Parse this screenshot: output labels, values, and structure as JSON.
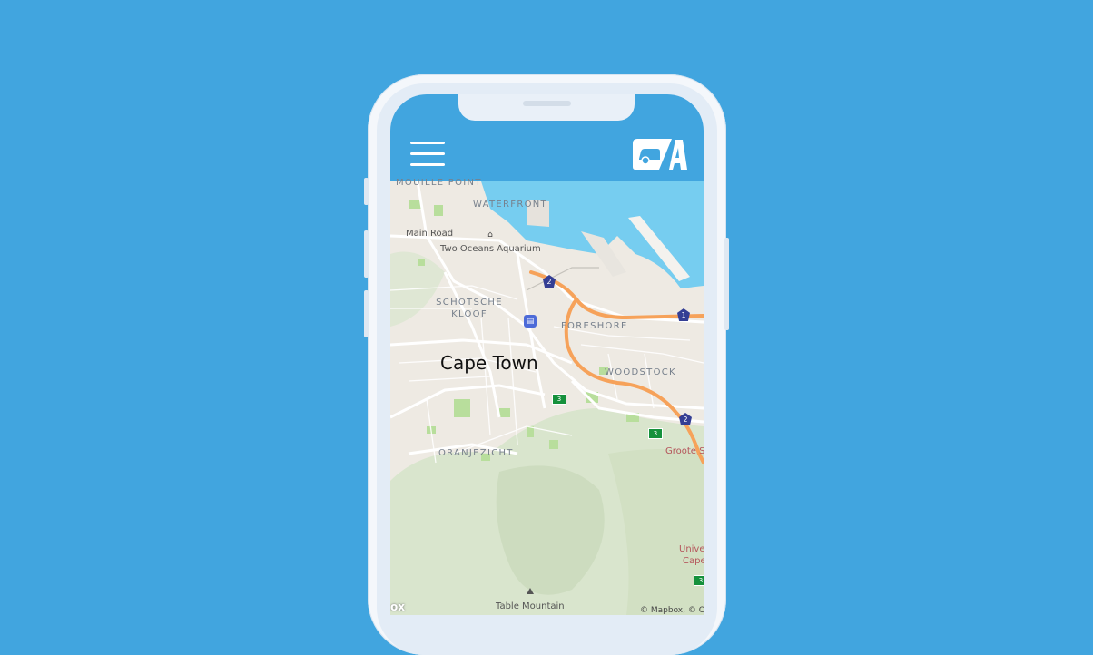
{
  "app": {
    "header_color": "#41a5df",
    "menu_icon": "hamburger-menu-icon",
    "logo_icon": "car-a-logo-icon"
  },
  "map": {
    "city_label": "Cape Town",
    "area_labels": [
      "MOUILLE POINT",
      "WATERFRONT",
      "SCHOTSCHE KLOOF",
      "FORESHORE",
      "WOODSTOCK",
      "ORANJEZICHT"
    ],
    "poi_labels": {
      "main_road": "Main Road",
      "aquarium": "Two Oceans Aquarium",
      "table_mountain": "Table Mountain",
      "groote": "Groote S",
      "university": "Unive",
      "university_2": "Cape"
    },
    "route_shields": {
      "n2_a": "2",
      "n1": "1",
      "n2_b": "2",
      "m3_a": "3",
      "m3_b": "3",
      "m3_c": "3"
    },
    "attribution": "© Mapbox, © O",
    "logo_fragment": "ox",
    "colors": {
      "water": "#76cdf0",
      "land": "#eeeae3",
      "hills": "#d8e4c9",
      "park": "#b5dd9a",
      "highway": "#f6a25a",
      "road": "#ffffff",
      "shield_blue": "#343e94",
      "shield_green": "#15913c"
    }
  }
}
